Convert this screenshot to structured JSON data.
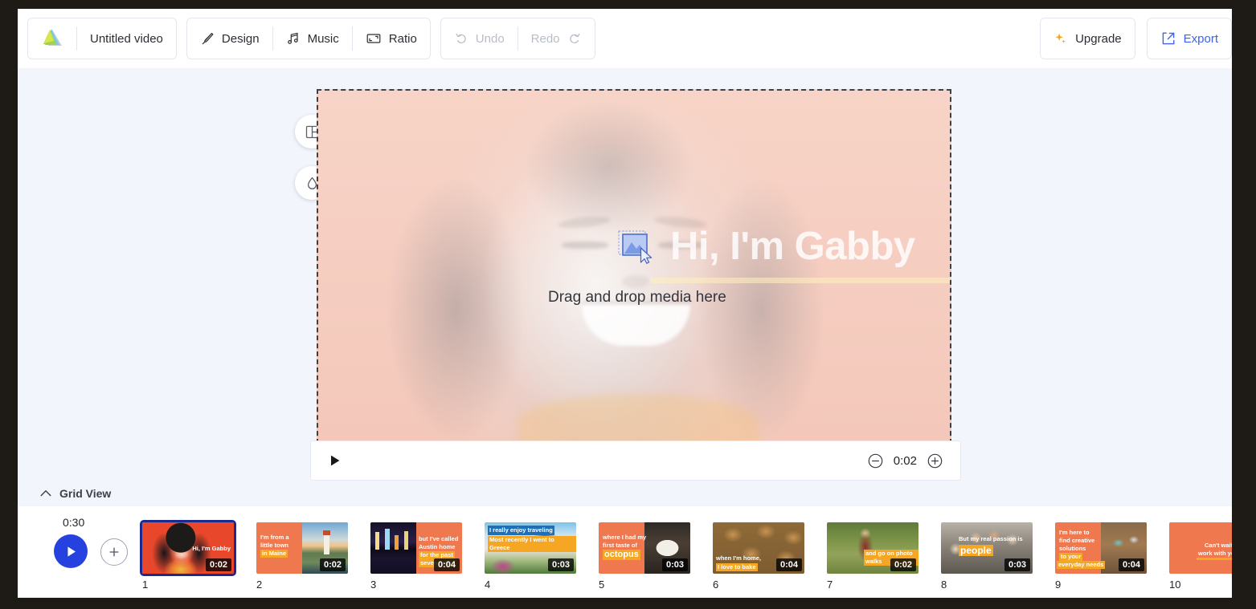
{
  "app": {
    "logo_icon": "spark-triangle-logo",
    "project_title": "Untitled video"
  },
  "toolbar": {
    "design_label": "Design",
    "design_icon": "brush-icon",
    "music_label": "Music",
    "music_icon": "music-note-icon",
    "ratio_label": "Ratio",
    "ratio_icon": "aspect-ratio-icon",
    "undo_label": "Undo",
    "undo_icon": "undo-arrow-icon",
    "redo_label": "Redo",
    "redo_icon": "redo-arrow-icon",
    "upgrade_label": "Upgrade",
    "upgrade_icon": "sparkle-icon",
    "export_label": "Export",
    "export_icon": "export-arrow-icon",
    "accent_blue": "#3b63f0",
    "upgrade_orange": "#f5a623"
  },
  "canvas": {
    "slide_title": "Hi, I'm Gabby",
    "drop_hint": "Drag and drop media here",
    "media_icon": "image-placeholder-icon",
    "cursor_icon": "mouse-pointer-icon",
    "layout_icon": "layout-grid-icon",
    "color_icon": "water-drop-icon",
    "background_color": "#f3c8ba",
    "highlight_color": "#fff0be"
  },
  "player": {
    "play_icon": "play-triangle-icon",
    "zoom_out_icon": "minus-circle-icon",
    "zoom_in_icon": "plus-circle-icon",
    "current_time": "0:02"
  },
  "gridbar": {
    "toggle_icon": "chevron-up-icon",
    "label": "Grid View"
  },
  "timeline": {
    "total_duration": "0:30",
    "play_icon": "play-circle-icon",
    "add_icon": "plus-circle-icon",
    "play_button_color": "#2541e0",
    "clips": [
      {
        "number": "1",
        "duration": "0:02",
        "caption": "Hi, I'm Gabby",
        "selected": true
      },
      {
        "number": "2",
        "duration": "0:02",
        "caption": "I'm from a little town in Maine",
        "selected": false
      },
      {
        "number": "3",
        "duration": "0:04",
        "caption": "but I've called Austin home for the past seven years",
        "selected": false
      },
      {
        "number": "4",
        "duration": "0:03",
        "caption": "I really enjoy traveling Most recently I went to Greece",
        "selected": false
      },
      {
        "number": "5",
        "duration": "0:03",
        "caption": "where I had my first taste of octopus",
        "selected": false
      },
      {
        "number": "6",
        "duration": "0:04",
        "caption": "when I'm home, I love to bake",
        "selected": false
      },
      {
        "number": "7",
        "duration": "0:02",
        "caption": "and go on photo walks",
        "selected": false
      },
      {
        "number": "8",
        "duration": "0:03",
        "caption": "But my real passion is people",
        "selected": false
      },
      {
        "number": "9",
        "duration": "0:04",
        "caption": "I'm here to find creative solutions to your everyday needs",
        "selected": false
      },
      {
        "number": "10",
        "duration": "",
        "caption": "Can't wait to work with you",
        "selected": false
      }
    ],
    "clip_captions": {
      "c1": "Hi, I'm Gabby",
      "c2a": "I'm from a",
      "c2b": "little town",
      "c2c": "in Maine",
      "c3a": "but I've called",
      "c3b": "Austin home",
      "c3c": "for the past",
      "c3d": "seven years",
      "c4a": "I really enjoy traveling",
      "c4b": "Most recently I went to Greece",
      "c5a": "where I had my",
      "c5b": "first taste of",
      "c5c": "octopus",
      "c6a": "when I'm home,",
      "c6b": "I love to bake",
      "c7a": "and go on photo walks",
      "c8a": "But my real passion is",
      "c8b": "people",
      "c9a": "I'm here to",
      "c9b": "find creative",
      "c9c": "solutions",
      "c9d": "to your",
      "c9e": "everyday needs",
      "c10a": "Can't wait to",
      "c10b": "work with you"
    }
  }
}
